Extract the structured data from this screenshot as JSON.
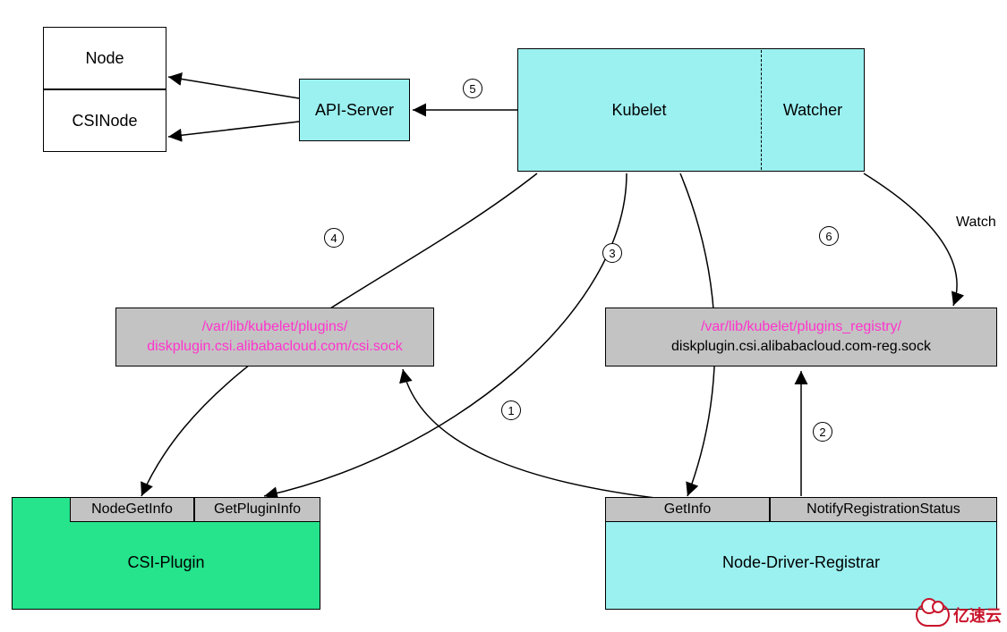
{
  "nodes": {
    "node": "Node",
    "csinode": "CSINode",
    "apiServer": "API-Server",
    "kubelet": "Kubelet",
    "watcher": "Watcher",
    "watchLabel": "Watch",
    "pluginSock": {
      "line1": "/var/lib/kubelet/plugins/",
      "line2": "diskplugin.csi.alibabacloud.com/csi.sock"
    },
    "registrySock": {
      "line1": "/var/lib/kubelet/plugins_registry/",
      "line2": "diskplugin.csi.alibabacloud.com-reg.sock"
    },
    "csiPlugin": {
      "title": "CSI-Plugin",
      "nodeGetInfo": "NodeGetInfo",
      "getPluginInfo": "GetPluginInfo"
    },
    "ndr": {
      "title": "Node-Driver-Registrar",
      "getInfo": "GetInfo",
      "notify": "NotifyRegistrationStatus"
    }
  },
  "steps": {
    "s1": "1",
    "s2": "2",
    "s3": "3",
    "s4": "4",
    "s5": "5",
    "s6": "6"
  },
  "watermark": "亿速云"
}
